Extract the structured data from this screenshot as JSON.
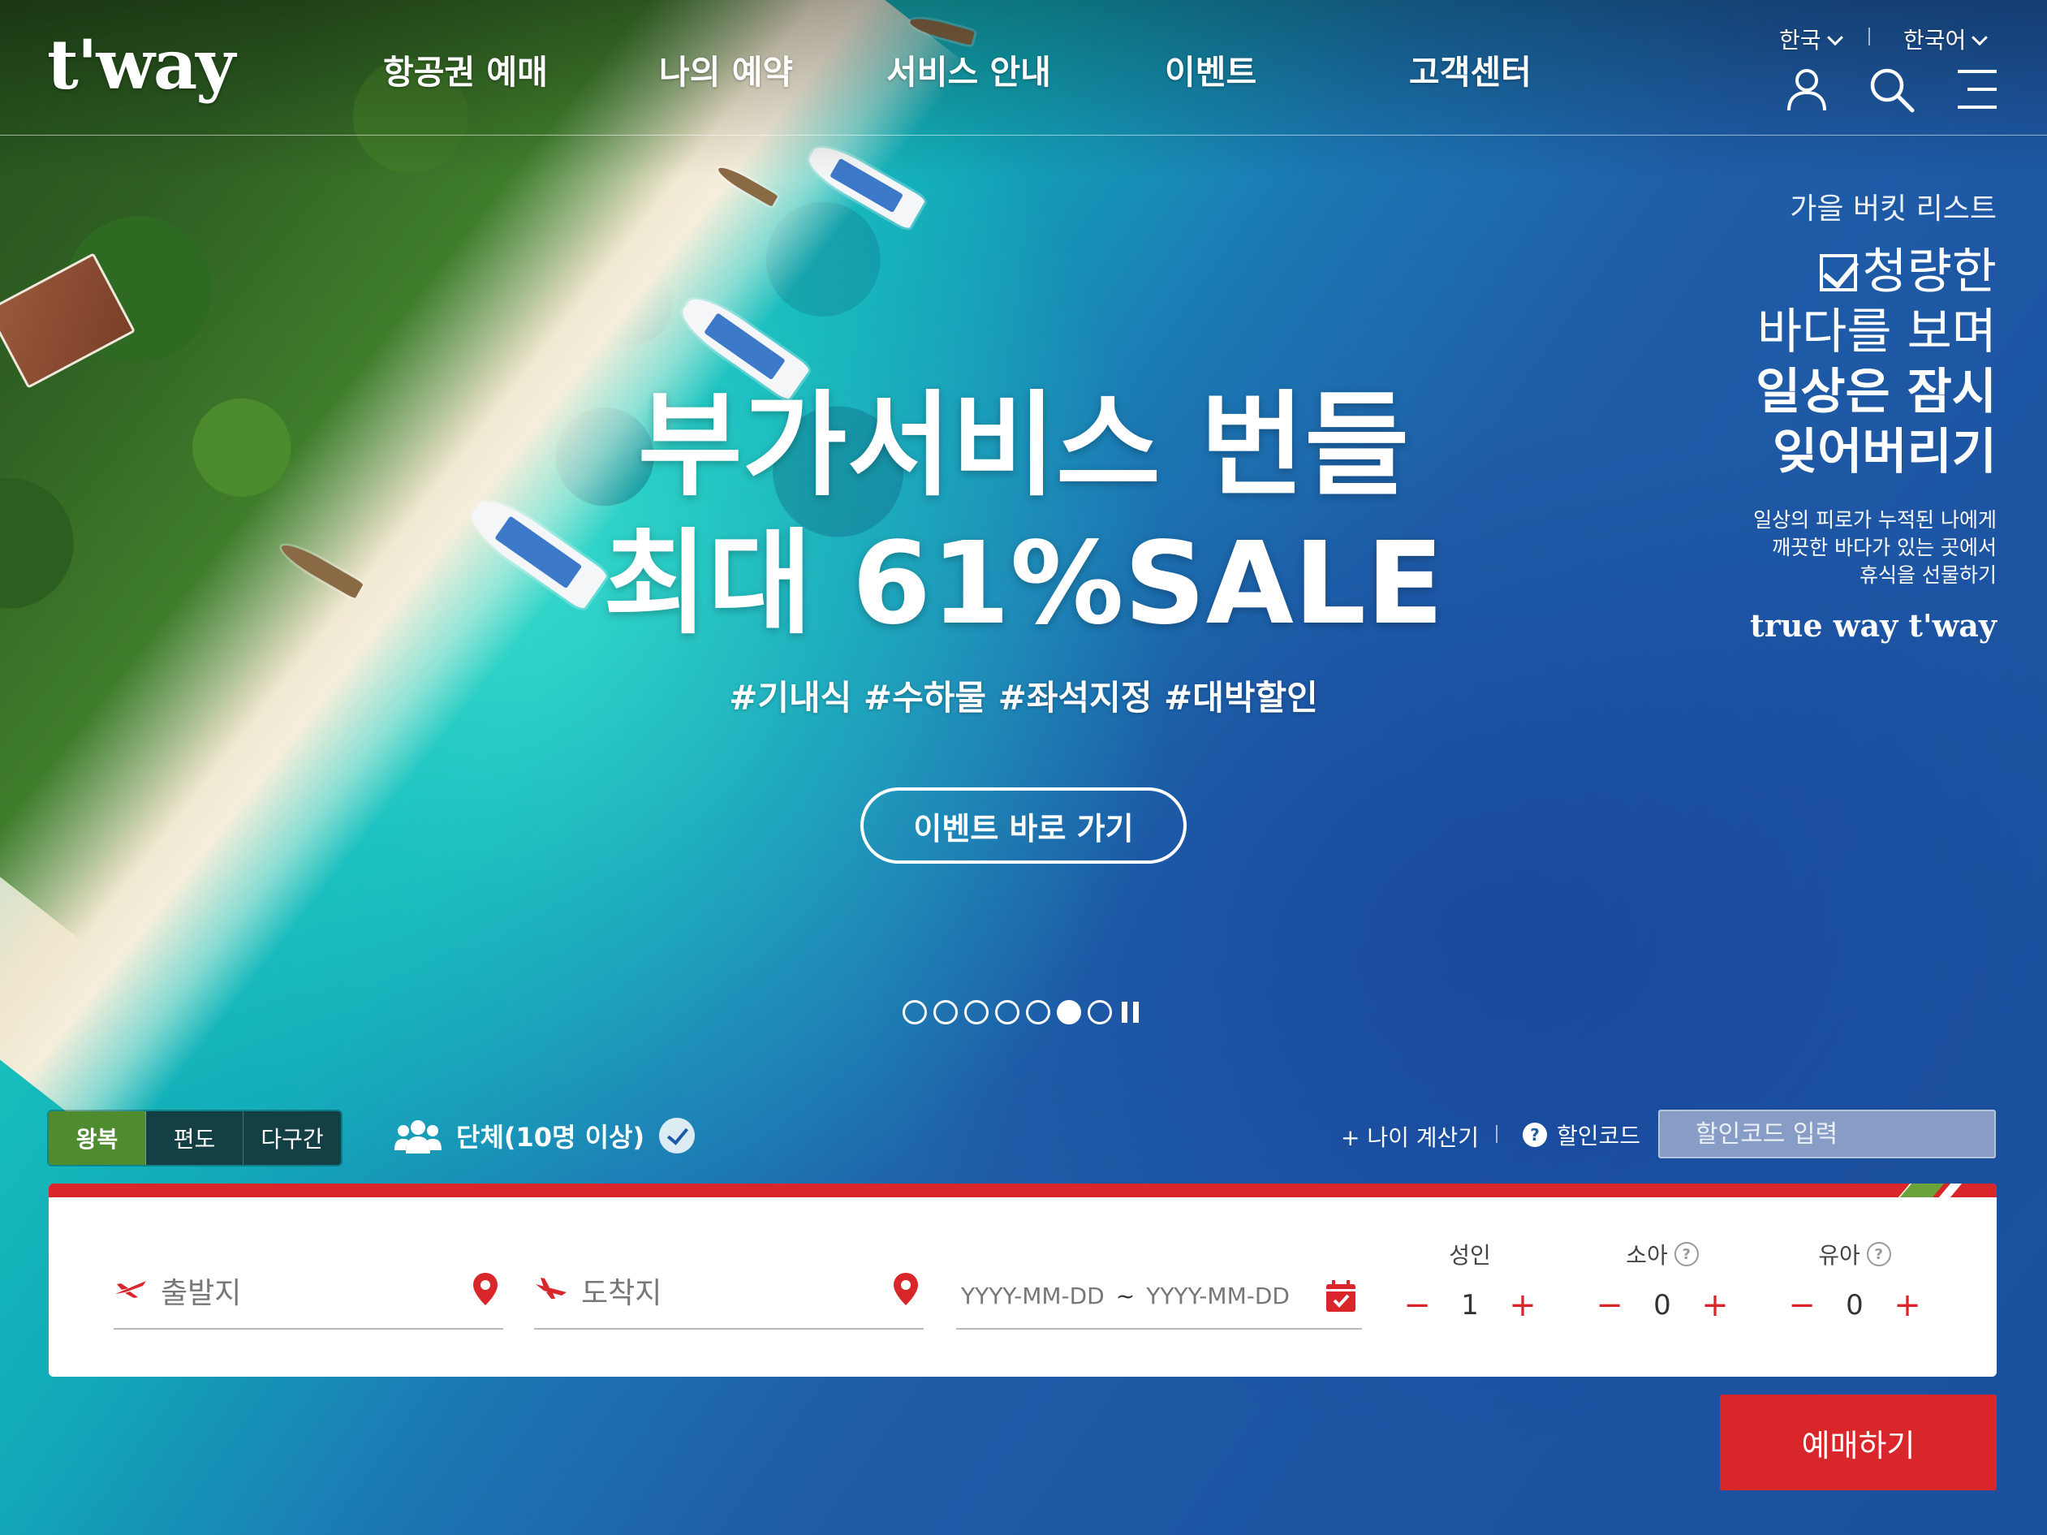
{
  "header": {
    "logo": "t'way",
    "nav": [
      "항공권 예매",
      "나의 예약",
      "서비스 안내",
      "이벤트",
      "고객센터"
    ],
    "region": "한국",
    "language": "한국어",
    "icons": [
      "user-icon",
      "search-icon",
      "menu-icon"
    ]
  },
  "side_copy": {
    "kicker": "가을 버킷 리스트",
    "line1": "청량한",
    "line2": "바다를 보며",
    "line3": "일상은 잠시",
    "line4": "잊어버리기",
    "desc1": "일상의 피로가 누적된 나에게",
    "desc2": "깨끗한 바다가 있는 곳에서",
    "desc3": "휴식을 선물하기",
    "brand": "true way t'way"
  },
  "hero": {
    "line1": "부가서비스 번들",
    "line2": "최대 61%SALE",
    "tags": "#기내식 #수하물 #좌석지정 #대박할인",
    "cta": "이벤트 바로 가기"
  },
  "slider": {
    "total": 7,
    "active_index": 6
  },
  "booking": {
    "trip_types": [
      "왕복",
      "편도",
      "다구간"
    ],
    "active_trip_type": "왕복",
    "group_label": "단체(10명 이상)",
    "age_calc": "+ 나이 계산기",
    "promo_label": "할인코드",
    "promo_placeholder": "할인코드 입력",
    "origin_placeholder": "출발지",
    "destination_placeholder": "도착지",
    "date_start_placeholder": "YYYY-MM-DD",
    "date_separator": "~",
    "date_end_placeholder": "YYYY-MM-DD",
    "passengers": [
      {
        "label": "성인",
        "count": "1",
        "help": false
      },
      {
        "label": "소아",
        "count": "0",
        "help": true
      },
      {
        "label": "유아",
        "count": "0",
        "help": true
      }
    ],
    "book_button": "예매하기"
  },
  "colors": {
    "brand_red": "#d8262b",
    "brand_green": "#4f8b2f",
    "tab_dark": "#133f45"
  }
}
